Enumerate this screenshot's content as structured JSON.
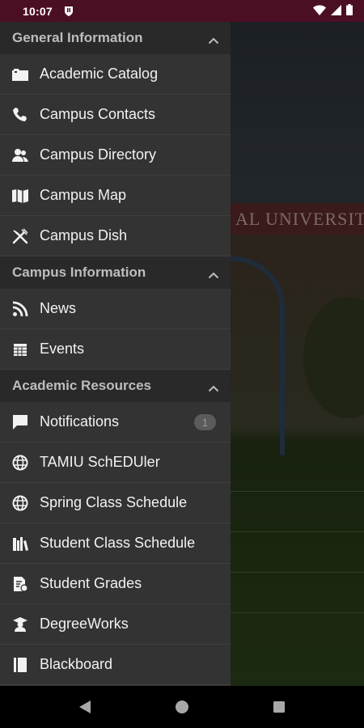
{
  "status_bar": {
    "time": "10:07"
  },
  "background": {
    "banner_text": "AL UNIVERSITY"
  },
  "drawer": {
    "sections": [
      {
        "title": "General Information",
        "items": [
          {
            "label": "Academic Catalog",
            "icon": "folder-icon"
          },
          {
            "label": "Campus Contacts",
            "icon": "phone-icon"
          },
          {
            "label": "Campus Directory",
            "icon": "people-icon"
          },
          {
            "label": "Campus Map",
            "icon": "map-icon"
          },
          {
            "label": "Campus Dish",
            "icon": "utensils-icon"
          }
        ]
      },
      {
        "title": "Campus Information",
        "items": [
          {
            "label": "News",
            "icon": "rss-icon"
          },
          {
            "label": "Events",
            "icon": "calendar-icon"
          }
        ]
      },
      {
        "title": "Academic Resources",
        "items": [
          {
            "label": "Notifications",
            "icon": "chat-icon",
            "badge": "1"
          },
          {
            "label": "TAMIU SchEDUler",
            "icon": "globe-icon"
          },
          {
            "label": "Spring Class Schedule",
            "icon": "globe-icon"
          },
          {
            "label": "Student Class Schedule",
            "icon": "books-icon"
          },
          {
            "label": "Student Grades",
            "icon": "grades-icon"
          },
          {
            "label": "DegreeWorks",
            "icon": "graduate-icon"
          },
          {
            "label": "Blackboard",
            "icon": "book-icon"
          }
        ]
      }
    ]
  },
  "colors": {
    "status_bar": "#4b0f24",
    "drawer": "#333333",
    "section_header": "#292929",
    "text": "#f2f2f2"
  }
}
